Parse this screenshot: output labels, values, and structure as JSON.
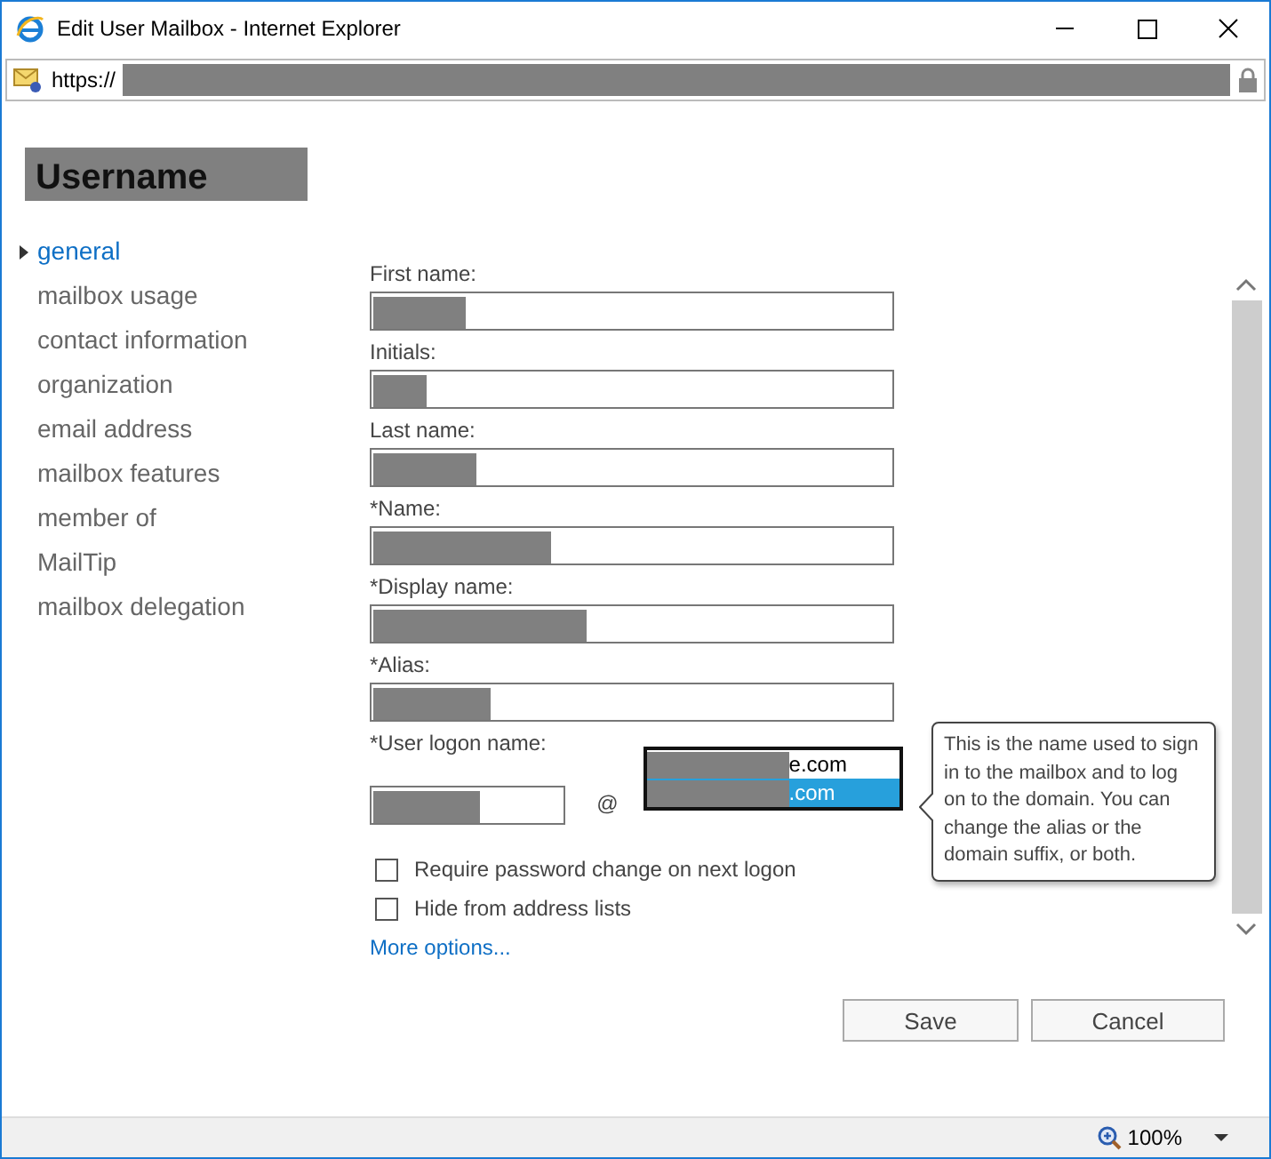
{
  "window": {
    "title": "Edit User Mailbox - Internet Explorer"
  },
  "address_bar": {
    "url": "https://"
  },
  "heading": "Username",
  "nav": [
    {
      "label": "general",
      "selected": true
    },
    {
      "label": "mailbox usage",
      "selected": false
    },
    {
      "label": "contact information",
      "selected": false
    },
    {
      "label": "organization",
      "selected": false
    },
    {
      "label": "email address",
      "selected": false
    },
    {
      "label": "mailbox features",
      "selected": false
    },
    {
      "label": "member of",
      "selected": false
    },
    {
      "label": "MailTip",
      "selected": false
    },
    {
      "label": "mailbox delegation",
      "selected": false
    }
  ],
  "fields": [
    {
      "label": "First name:"
    },
    {
      "label": "Initials:"
    },
    {
      "label": "Last name:"
    },
    {
      "label": "*Name:"
    },
    {
      "label": "*Display name:"
    },
    {
      "label": "*Alias:"
    }
  ],
  "logon": {
    "label": "*User logon name:",
    "at": "@",
    "domains": [
      {
        "text": "e.com",
        "selected": false
      },
      {
        "text": ".com",
        "selected": true
      }
    ]
  },
  "checkboxes": [
    {
      "label": "Require password change on next logon",
      "checked": false
    },
    {
      "label": "Hide from address lists",
      "checked": false
    }
  ],
  "more_options": "More options...",
  "tooltip": "This is the name used to sign in to the mailbox and to log on to the domain. You can change the alias or the domain suffix, or both.",
  "buttons": [
    "Save",
    "Cancel"
  ],
  "status_bar": {
    "zoom": "100%"
  }
}
